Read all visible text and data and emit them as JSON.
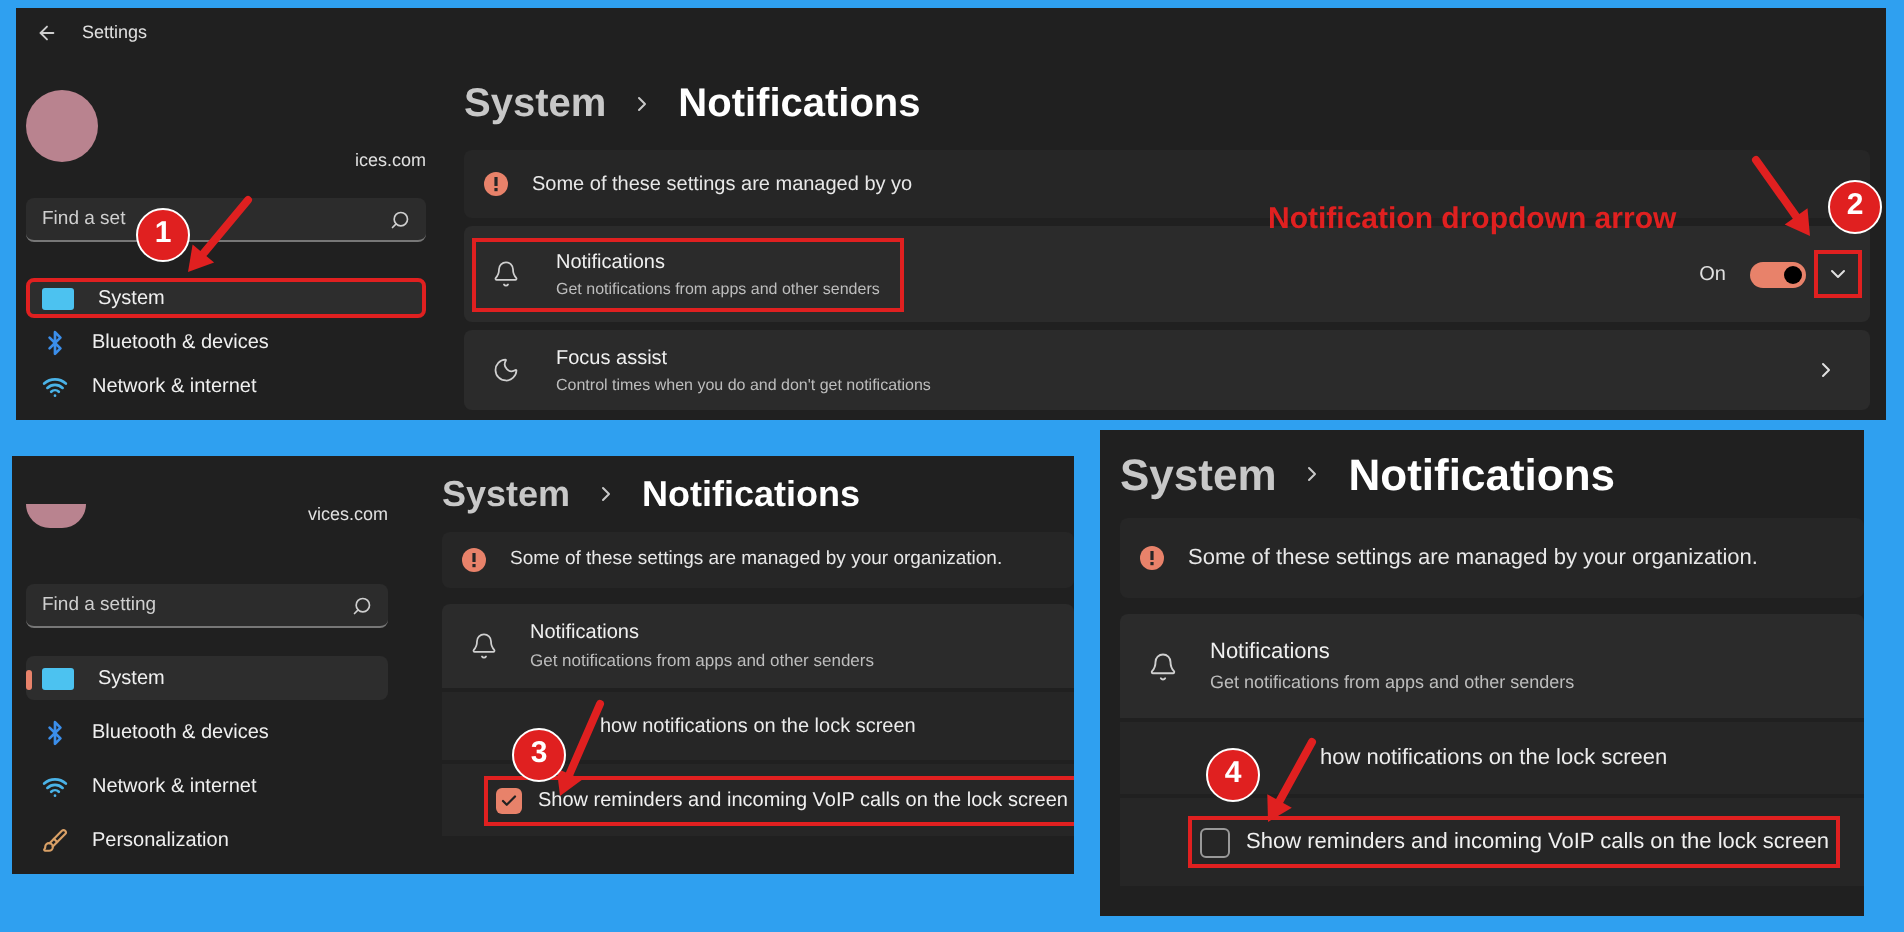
{
  "top_panel": {
    "window_title": "Settings",
    "account_email": "ices.com",
    "search": {
      "placeholder": "Find a set"
    },
    "nav": [
      {
        "label": "System",
        "kind": "system",
        "selected": true,
        "highlighted": true
      },
      {
        "label": "Bluetooth & devices",
        "kind": "bluetooth",
        "selected": false,
        "highlighted": false
      },
      {
        "label": "Network & internet",
        "kind": "network",
        "selected": false,
        "highlighted": false
      }
    ],
    "breadcrumb": {
      "parent": "System",
      "current": "Notifications"
    },
    "notice": "Some of these settings are managed by yo",
    "settings": [
      {
        "kind": "toggle",
        "title": "Notifications",
        "subtitle": "Get notifications from apps and other senders",
        "state_label": "On",
        "on": true,
        "highlighted": true,
        "dropdown_highlighted": true
      },
      {
        "kind": "link",
        "title": "Focus assist",
        "subtitle": "Control times when you do and don't get notifications"
      }
    ]
  },
  "callout": "Notification dropdown arrow",
  "bottom_left_panel": {
    "account_email": "vices.com",
    "search": {
      "placeholder": "Find a setting"
    },
    "nav": [
      {
        "label": "System",
        "kind": "system",
        "selected": true,
        "highlighted": false
      },
      {
        "label": "Bluetooth & devices",
        "kind": "bluetooth",
        "selected": false,
        "highlighted": false
      },
      {
        "label": "Network & internet",
        "kind": "network",
        "selected": false,
        "highlighted": false
      },
      {
        "label": "Personalization",
        "kind": "personalization",
        "selected": false,
        "highlighted": false
      }
    ],
    "breadcrumb": {
      "parent": "System",
      "current": "Notifications"
    },
    "notice": "Some of these settings are managed by your organization.",
    "settings": [
      {
        "kind": "header",
        "title": "Notifications",
        "subtitle": "Get notifications from apps and other senders"
      },
      {
        "kind": "option",
        "label": "how notifications on the lock screen"
      },
      {
        "kind": "checkbox",
        "label": "Show reminders and incoming VoIP calls on the lock screen",
        "checked": true,
        "highlighted": true
      }
    ]
  },
  "bottom_right_panel": {
    "breadcrumb": {
      "parent": "System",
      "current": "Notifications"
    },
    "notice": "Some of these settings are managed by your organization.",
    "settings": [
      {
        "kind": "header",
        "title": "Notifications",
        "subtitle": "Get notifications from apps and other senders"
      },
      {
        "kind": "option",
        "label": "how notifications on the lock screen"
      },
      {
        "kind": "checkbox",
        "label": "Show reminders and incoming VoIP calls on the lock screen",
        "checked": false,
        "highlighted": true
      }
    ]
  },
  "step_badges": [
    {
      "label": "1"
    },
    {
      "label": "2"
    },
    {
      "label": "3"
    },
    {
      "label": "4"
    }
  ]
}
